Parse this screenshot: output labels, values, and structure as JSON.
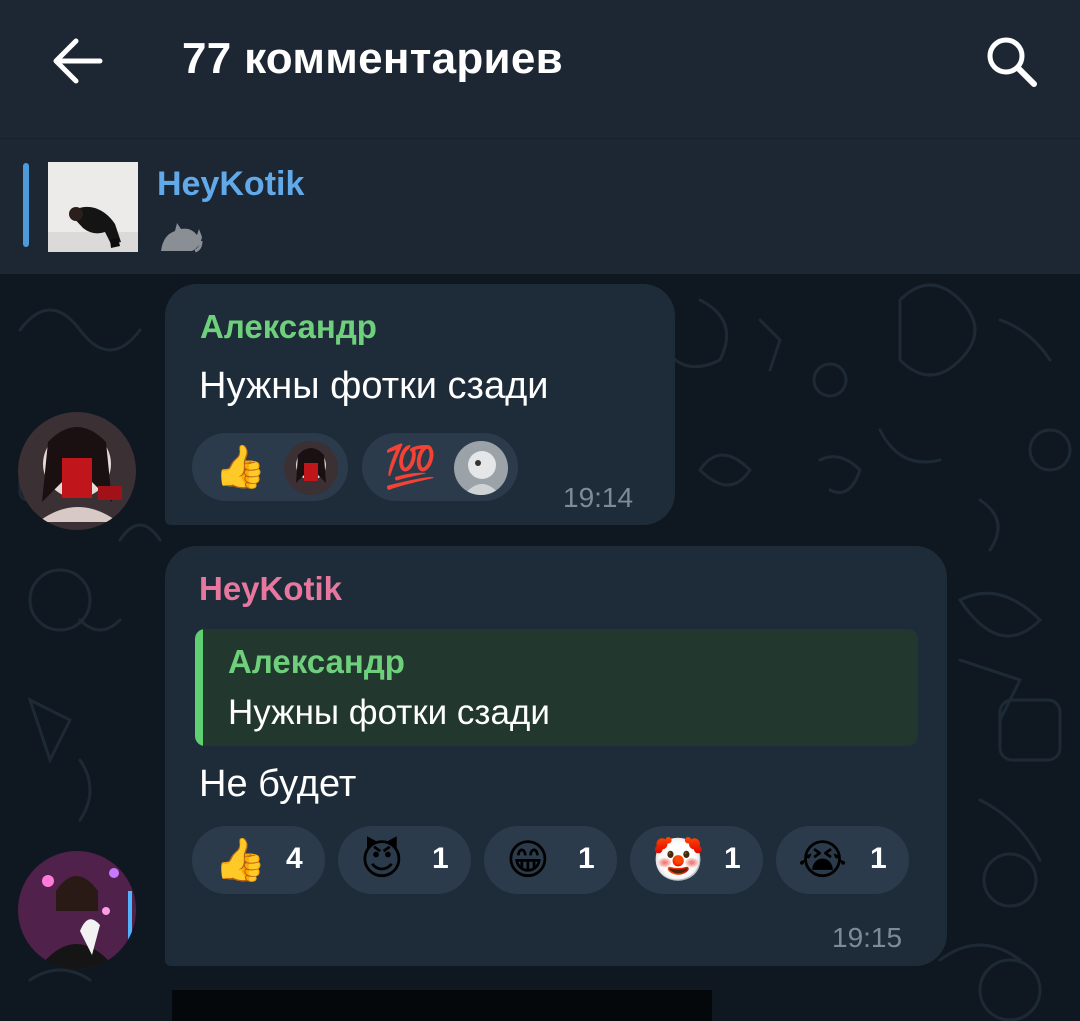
{
  "header": {
    "title": "77 комментариев"
  },
  "pinned": {
    "author": "HeyKotik",
    "text_icon": "cat-emoji"
  },
  "messages": [
    {
      "author": "Александр",
      "author_color": "#6fd07c",
      "text": "Нужны фотки сзади",
      "time": "19:14",
      "reactions": [
        {
          "emoji": "👍",
          "icon": "thumbs-up"
        },
        {
          "emoji": "💯",
          "icon": "hundred-points"
        }
      ]
    },
    {
      "author": "HeyKotik",
      "author_color": "#e8779f",
      "reply": {
        "author": "Александр",
        "text": "Нужны фотки сзади"
      },
      "text": "Не будет",
      "time": "19:15",
      "reactions": [
        {
          "emoji": "👍",
          "count": "4"
        },
        {
          "emoji": "😈",
          "count": "1"
        },
        {
          "emoji": "😁",
          "count": "1"
        },
        {
          "emoji": "🤡",
          "count": "1"
        },
        {
          "emoji": "😭",
          "count": "1"
        }
      ]
    }
  ],
  "colors": {
    "accent": "#61a9e8",
    "bubble": "#1e2c3a",
    "header": "#1c2733"
  }
}
